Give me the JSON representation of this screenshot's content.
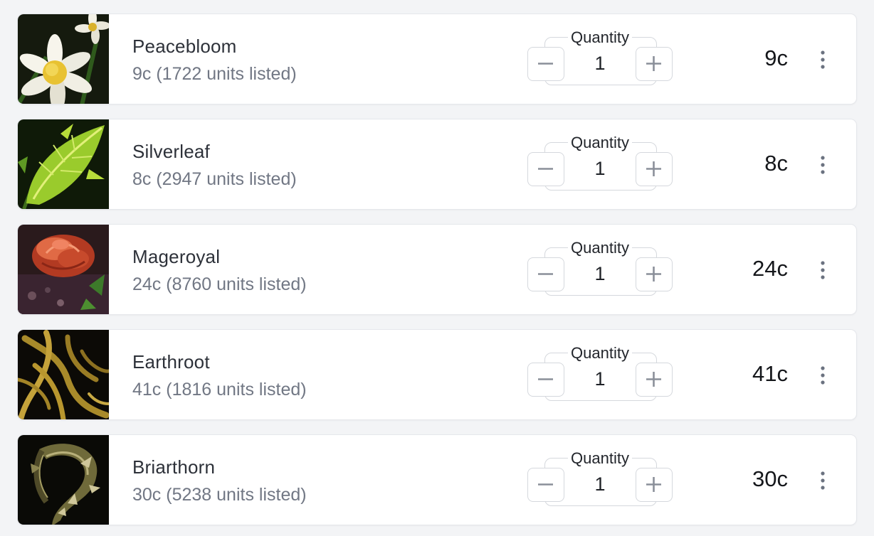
{
  "quantity_label": "Quantity",
  "items": [
    {
      "name": "Peacebloom",
      "listing": "9c (1722 units listed)",
      "quantity": "1",
      "price": "9c",
      "icon": "peacebloom-icon"
    },
    {
      "name": "Silverleaf",
      "listing": "8c (2947 units listed)",
      "quantity": "1",
      "price": "8c",
      "icon": "silverleaf-icon"
    },
    {
      "name": "Mageroyal",
      "listing": "24c (8760 units listed)",
      "quantity": "1",
      "price": "24c",
      "icon": "mageroyal-icon"
    },
    {
      "name": "Earthroot",
      "listing": "41c (1816 units listed)",
      "quantity": "1",
      "price": "41c",
      "icon": "earthroot-icon"
    },
    {
      "name": "Briarthorn",
      "listing": "30c (5238 units listed)",
      "quantity": "1",
      "price": "30c",
      "icon": "briarthorn-icon"
    }
  ],
  "colors": {
    "background": "#f3f4f6",
    "card": "#ffffff",
    "border": "#e5e7eb",
    "muted_text": "#717784",
    "button_icon": "#8a8f99"
  }
}
